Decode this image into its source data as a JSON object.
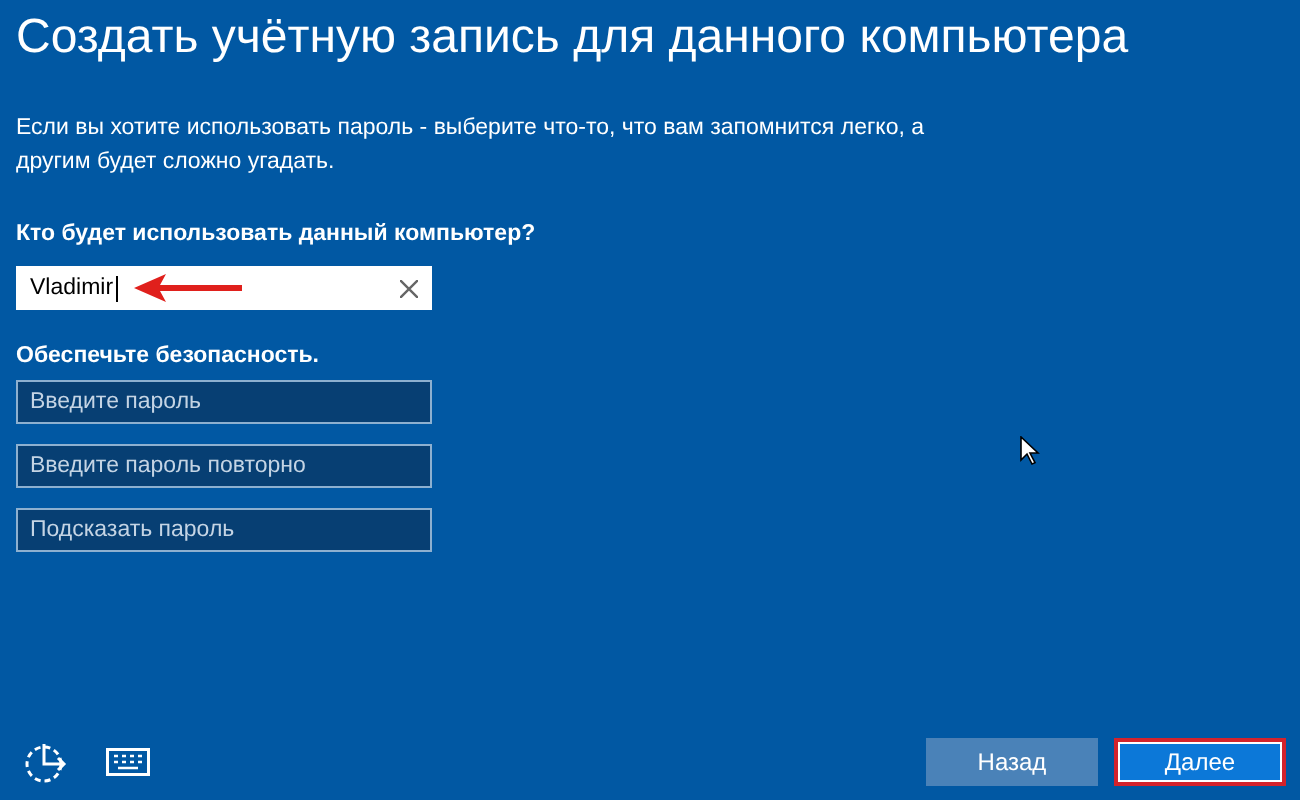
{
  "title": "Создать учётную запись для данного компьютера",
  "description": "Если вы хотите использовать пароль - выберите что-то, что вам запомнится легко, а другим будет сложно угадать.",
  "user_section": {
    "label": "Кто будет использовать данный компьютер?",
    "value": "Vladimir",
    "annotation_arrow": true
  },
  "security_section": {
    "label": "Обеспечьте безопасность.",
    "fields": [
      {
        "placeholder": "Введите пароль"
      },
      {
        "placeholder": "Введите пароль повторно"
      },
      {
        "placeholder": "Подсказать пароль"
      }
    ]
  },
  "buttons": [
    {
      "label": "Назад",
      "kind": "secondary",
      "annotated": false
    },
    {
      "label": "Далее",
      "kind": "primary",
      "annotated": true
    }
  ]
}
